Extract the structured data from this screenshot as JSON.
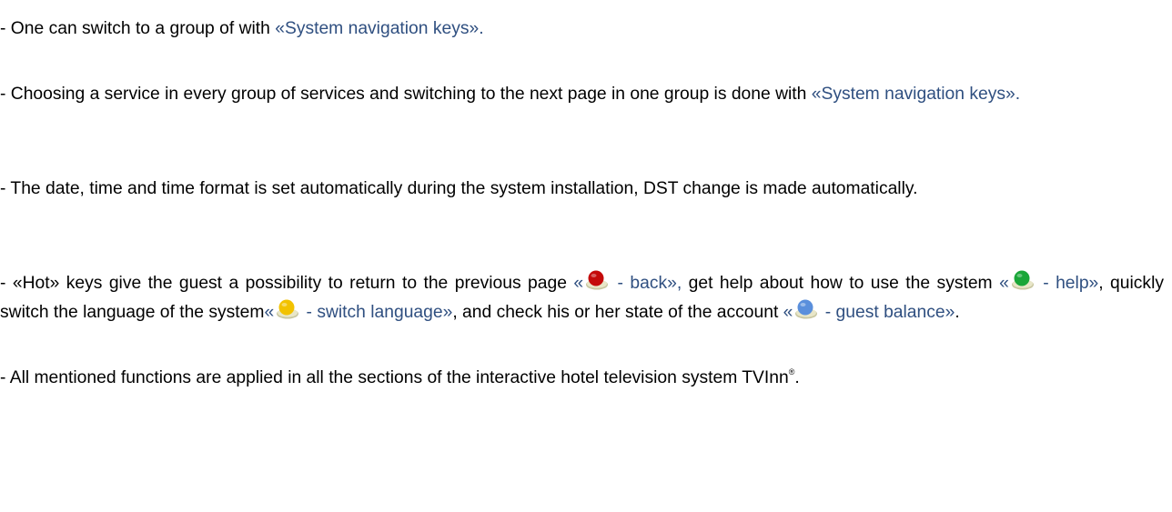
{
  "paragraphs": {
    "p1": {
      "text1": "- One can switch to a group of with ",
      "link1": "«System navigation keys»."
    },
    "p2": {
      "text1": "- Choosing a service in every group of services and switching to the next page in one group is done with ",
      "link1": "«System navigation keys»."
    },
    "p3": {
      "text1": "- The date, time and time format is set automatically during the system installation, DST change is made automatically."
    },
    "p4": {
      "text1": "- «Hot» keys give the guest a possibility to return to the previous page ",
      "red_open": "«",
      "red_label": " - back»,",
      "text2": " get help about how to use the system ",
      "green_open": "«",
      "green_label": " - help»",
      "text3": ", quickly switch the language of the system",
      "yellow_open": "«",
      "yellow_label": " - switch language»",
      "text4": ", and check his or her state of the account ",
      "blue_open": "«",
      "blue_label": " - guest balance»",
      "text5": "."
    },
    "p5": {
      "text1": "- All mentioned functions are applied in all the sections of the interactive hotel television system TVInn",
      "trademark": "®",
      "text2": "."
    }
  },
  "colors": {
    "text": "#000000",
    "link": "#2f4f80",
    "red_key": "#c40a0a",
    "green_key": "#1aa638",
    "yellow_key": "#f2c200",
    "blue_key": "#5a8fdc"
  },
  "icons": {
    "red": "red-remote-key-icon",
    "green": "green-remote-key-icon",
    "yellow": "yellow-remote-key-icon",
    "blue": "blue-remote-key-icon"
  }
}
